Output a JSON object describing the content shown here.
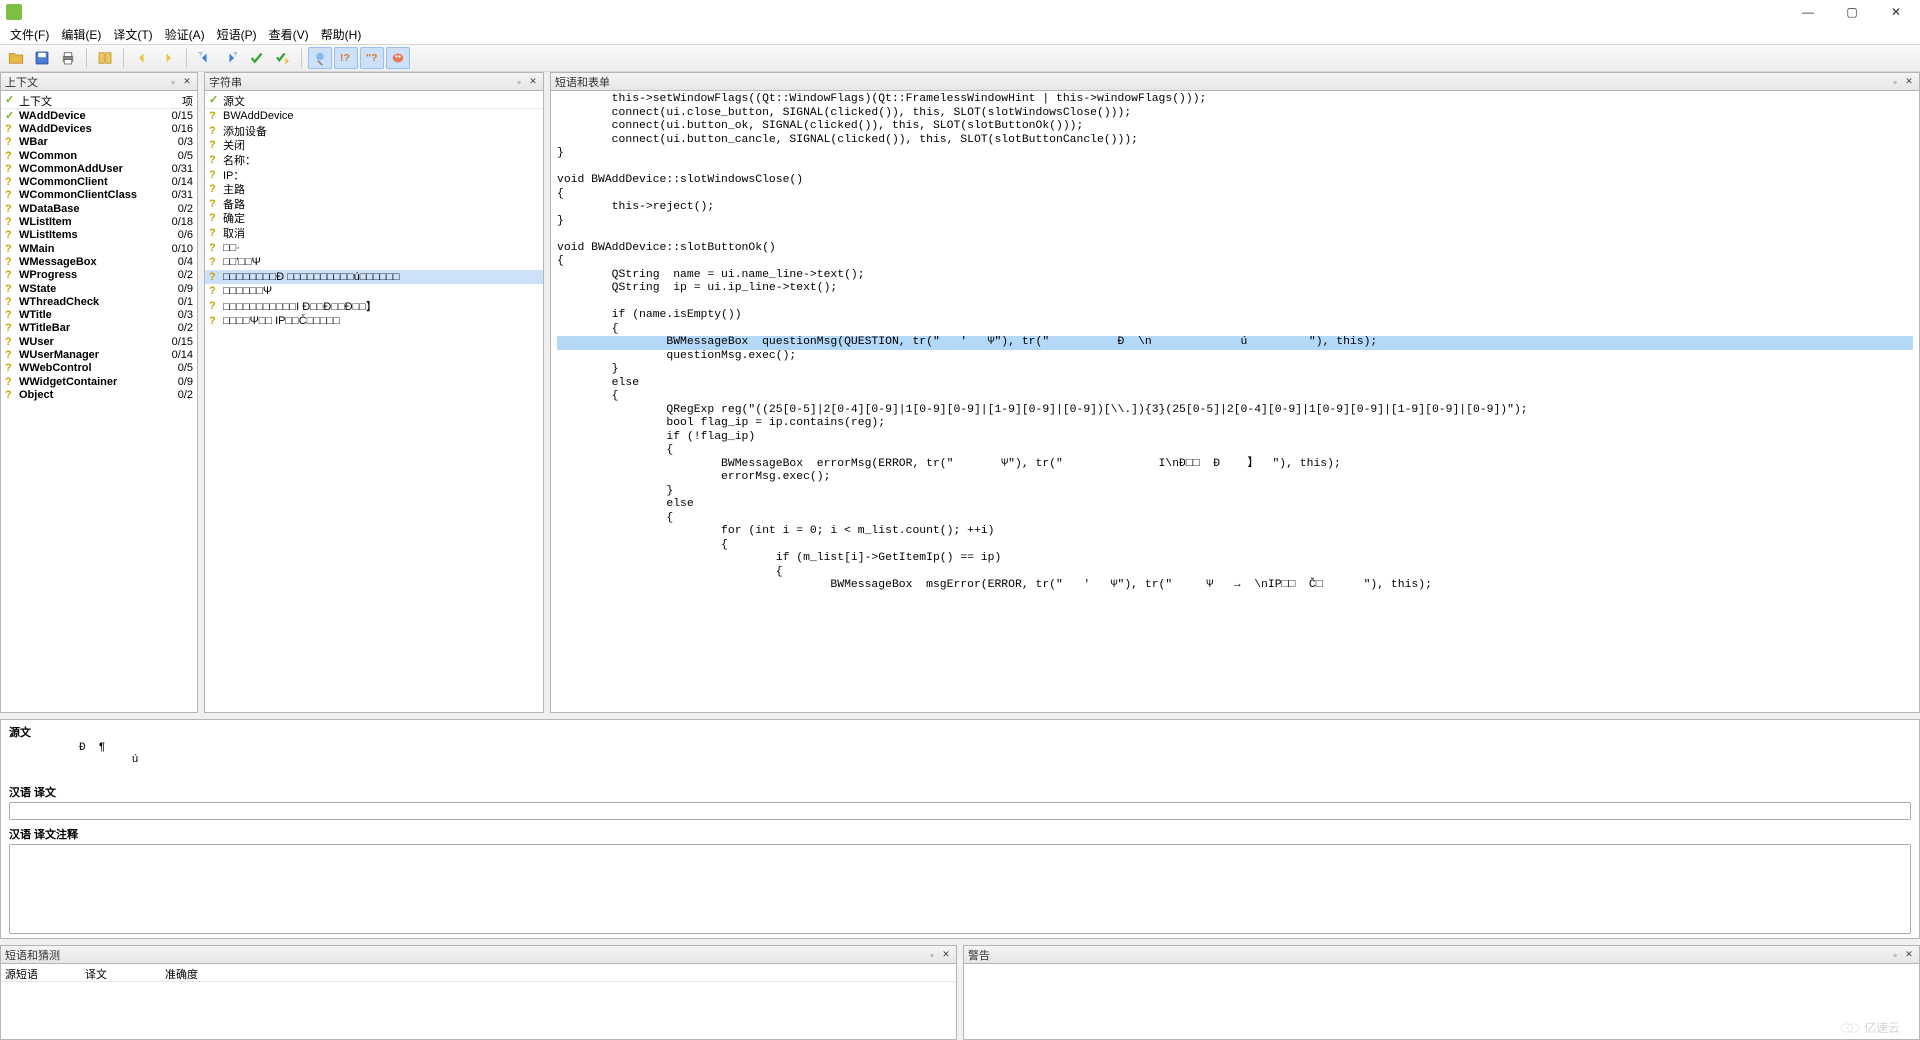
{
  "menu": [
    "文件(F)",
    "编辑(E)",
    "译文(T)",
    "验证(A)",
    "短语(P)",
    "查看(V)",
    "帮助(H)"
  ],
  "panels": {
    "context_title": "上下文",
    "strings_title": "字符串",
    "sourceforms_title": "短语和表单",
    "phrasesguess_title": "短语和猜测",
    "warnings_title": "警告"
  },
  "context_header": {
    "col1": "上下文",
    "col2": "项"
  },
  "contexts": [
    {
      "m": "c",
      "name": "WAddDevice",
      "count": "0/15"
    },
    {
      "m": "q",
      "name": "WAddDevices",
      "count": "0/16"
    },
    {
      "m": "q",
      "name": "WBar",
      "count": "0/3"
    },
    {
      "m": "q",
      "name": "WCommon",
      "count": "0/5"
    },
    {
      "m": "q",
      "name": "WCommonAddUser",
      "count": "0/31"
    },
    {
      "m": "q",
      "name": "WCommonClient",
      "count": "0/14"
    },
    {
      "m": "q",
      "name": "WCommonClientClass",
      "count": "0/31"
    },
    {
      "m": "q",
      "name": "WDataBase",
      "count": "0/2"
    },
    {
      "m": "q",
      "name": "WListItem",
      "count": "0/18"
    },
    {
      "m": "q",
      "name": "WListItems",
      "count": "0/6"
    },
    {
      "m": "q",
      "name": "WMain",
      "count": "0/10"
    },
    {
      "m": "q",
      "name": "WMessageBox",
      "count": "0/4"
    },
    {
      "m": "q",
      "name": "WProgress",
      "count": "0/2"
    },
    {
      "m": "q",
      "name": "WState",
      "count": "0/9"
    },
    {
      "m": "q",
      "name": "WThreadCheck",
      "count": "0/1"
    },
    {
      "m": "q",
      "name": "WTitle",
      "count": "0/3"
    },
    {
      "m": "q",
      "name": "WTitleBar",
      "count": "0/2"
    },
    {
      "m": "q",
      "name": "WUser",
      "count": "0/15"
    },
    {
      "m": "q",
      "name": "WUserManager",
      "count": "0/14"
    },
    {
      "m": "q",
      "name": "WWebControl",
      "count": "0/5"
    },
    {
      "m": "q",
      "name": "WWidgetContainer",
      "count": "0/9"
    },
    {
      "m": "q",
      "name": "Object",
      "count": "0/2"
    }
  ],
  "strings_header": "源文",
  "strings": [
    {
      "t": "BWAddDevice"
    },
    {
      "t": "添加设备"
    },
    {
      "t": "关闭"
    },
    {
      "t": "名称："
    },
    {
      "t": "IP："
    },
    {
      "t": "主路"
    },
    {
      "t": "备路"
    },
    {
      "t": "确定"
    },
    {
      "t": "取消"
    },
    {
      "t": "□□·"
    },
    {
      "t": "□□'□□Ψ"
    },
    {
      "t": "□□□□□□□□Đ □□□□□□□□□□ú□□□□□□",
      "sel": true
    },
    {
      "t": "□□□□□□Ψ"
    },
    {
      "t": "□□□□□□□□□□□I Đ□□Đ□□Đ□□】"
    },
    {
      "t": "□□□□Ψ□□ IP□□Č□□□□□"
    }
  ],
  "code_lines": [
    "        this->setWindowFlags((Qt::WindowFlags)(Qt::FramelessWindowHint | this->windowFlags()));",
    "        connect(ui.close_button, SIGNAL(clicked()), this, SLOT(slotWindowsClose()));",
    "        connect(ui.button_ok, SIGNAL(clicked()), this, SLOT(slotButtonOk()));",
    "        connect(ui.button_cancle, SIGNAL(clicked()), this, SLOT(slotButtonCancle()));",
    "}",
    "",
    "void BWAddDevice::slotWindowsClose()",
    "{",
    "        this->reject();",
    "}",
    "",
    "void BWAddDevice::slotButtonOk()",
    "{",
    "        QString  name = ui.name_line->text();",
    "        QString  ip = ui.ip_line->text();",
    "",
    "        if (name.isEmpty())",
    "        {",
    "HL:                BWMessageBox  questionMsg(QUESTION, tr(\"   '   Ψ\"), tr(\"          Đ  \\n             ú         \"), this);",
    "                questionMsg.exec();",
    "        }",
    "        else",
    "        {",
    "                QRegExp reg(\"((25[0-5]|2[0-4][0-9]|1[0-9][0-9]|[1-9][0-9]|[0-9])[\\\\.]){3}(25[0-5]|2[0-4][0-9]|1[0-9][0-9]|[1-9][0-9]|[0-9])\");",
    "                bool flag_ip = ip.contains(reg);",
    "                if (!flag_ip)",
    "                {",
    "                        BWMessageBox  errorMsg(ERROR, tr(\"       Ψ\"), tr(\"              I\\nĐ□□  Đ    】  \"), this);",
    "                        errorMsg.exec();",
    "                }",
    "                else",
    "                {",
    "                        for (int i = 0; i < m_list.count(); ++i)",
    "                        {",
    "                                if (m_list[i]->GetItemIp() == ip)",
    "                                {",
    "                                        BWMessageBox  msgError(ERROR, tr(\"   '   Ψ\"), tr(\"     Ψ   →  \\nIP□□  Č□      \"), this);"
  ],
  "translation": {
    "source_label": "源文",
    "source_chars": "Đ  ¶\n        ú",
    "target_label": "汉语 译文",
    "notes_label": "汉语 译文注释"
  },
  "guess_header": {
    "c1": "源短语",
    "c2": "译文",
    "c3": "准确度"
  },
  "watermark": "亿速云"
}
